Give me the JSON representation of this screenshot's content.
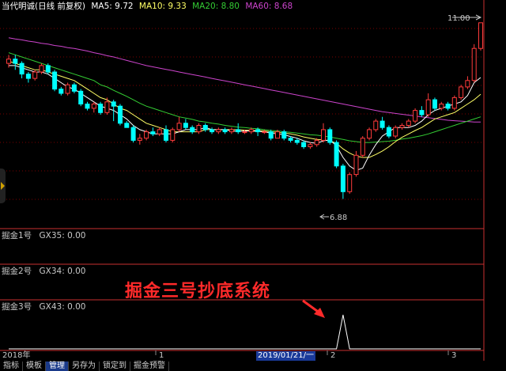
{
  "header": {
    "title": "当代明诚(日线 前复权)",
    "ma5_label": "MA5: 9.72",
    "ma10_label": "MA10: 9.33",
    "ma20_label": "MA20: 8.80",
    "ma60_label": "MA60: 8.68"
  },
  "price_labels": {
    "high": "11.00",
    "low": "6.88"
  },
  "indicators": [
    {
      "name": "掘金1号",
      "value": "GX35: 0.00"
    },
    {
      "name": "掘金2号",
      "value": "GX34: 0.00"
    },
    {
      "name": "掘金3号",
      "value": "GX43: 0.00"
    }
  ],
  "annotation": {
    "title": "掘金三号抄底系统"
  },
  "time_axis": {
    "year": "2018年",
    "tick1": "1",
    "cursor_date": "2019/01/21/一",
    "tick2": "2",
    "tick3": "3"
  },
  "bottom_tabs": [
    "指标",
    "模板",
    "管理",
    "另存为",
    "锁定到",
    "掘金预警"
  ],
  "colors": {
    "up": "#ff3b3b",
    "down": "#00ffff",
    "ma5": "#ffffff",
    "ma10": "#ffff66",
    "ma20": "#33cc33",
    "ma60": "#cc44cc",
    "grid": "#7a0000",
    "divider": "#c83030"
  },
  "chart_data": {
    "type": "candlestick",
    "y_range": [
      6.5,
      11.2
    ],
    "candles": [
      [
        10.05,
        10.15,
        10.25,
        9.95
      ],
      [
        10.15,
        10.05,
        10.25,
        9.9
      ],
      [
        10.05,
        9.8,
        10.1,
        9.7
      ],
      [
        9.8,
        9.7,
        9.85,
        9.6
      ],
      [
        9.7,
        9.85,
        9.9,
        9.65
      ],
      [
        9.85,
        10.0,
        10.05,
        9.8
      ],
      [
        10.0,
        9.85,
        10.05,
        9.8
      ],
      [
        9.85,
        9.45,
        9.9,
        9.4
      ],
      [
        9.45,
        9.35,
        9.5,
        9.3
      ],
      [
        9.35,
        9.55,
        9.6,
        9.3
      ],
      [
        9.55,
        9.4,
        9.6,
        9.35
      ],
      [
        9.4,
        9.1,
        9.45,
        9.05
      ],
      [
        9.1,
        9.0,
        9.15,
        8.95
      ],
      [
        9.0,
        9.1,
        9.15,
        8.9
      ],
      [
        9.1,
        8.9,
        9.15,
        8.85
      ],
      [
        8.9,
        9.15,
        9.25,
        8.85
      ],
      [
        9.15,
        9.05,
        9.2,
        8.7
      ],
      [
        9.05,
        8.65,
        9.1,
        8.6
      ],
      [
        8.65,
        8.55,
        8.7,
        8.55
      ],
      [
        8.55,
        8.25,
        8.6,
        8.2
      ],
      [
        8.25,
        8.3,
        8.4,
        8.15
      ],
      [
        8.3,
        8.45,
        8.5,
        8.25
      ],
      [
        8.45,
        8.4,
        8.55,
        8.35
      ],
      [
        8.4,
        8.5,
        8.55,
        8.35
      ],
      [
        8.5,
        8.25,
        8.6,
        8.2
      ],
      [
        8.25,
        8.5,
        8.55,
        8.2
      ],
      [
        8.5,
        8.65,
        8.8,
        8.45
      ],
      [
        8.65,
        8.55,
        8.75,
        8.5
      ],
      [
        8.55,
        8.45,
        8.6,
        8.4
      ],
      [
        8.45,
        8.6,
        8.65,
        8.4
      ],
      [
        8.6,
        8.5,
        8.65,
        8.45
      ],
      [
        8.5,
        8.45,
        8.55,
        8.4
      ],
      [
        8.45,
        8.5,
        8.55,
        8.4
      ],
      [
        8.5,
        8.45,
        8.55,
        8.4
      ],
      [
        8.45,
        8.5,
        8.55,
        8.4
      ],
      [
        8.5,
        8.45,
        8.65,
        8.4
      ],
      [
        8.45,
        8.45,
        8.5,
        8.4
      ],
      [
        8.45,
        8.5,
        8.55,
        8.4
      ],
      [
        8.5,
        8.45,
        8.55,
        8.35
      ],
      [
        8.45,
        8.45,
        8.5,
        8.4
      ],
      [
        8.45,
        8.3,
        8.5,
        8.25
      ],
      [
        8.3,
        8.45,
        8.5,
        8.3
      ],
      [
        8.45,
        8.3,
        8.5,
        8.25
      ],
      [
        8.3,
        8.25,
        8.35,
        8.2
      ],
      [
        8.25,
        8.2,
        8.3,
        8.15
      ],
      [
        8.2,
        8.1,
        8.25,
        8.05
      ],
      [
        8.1,
        8.15,
        8.2,
        8.05
      ],
      [
        8.15,
        8.25,
        8.3,
        8.1
      ],
      [
        8.25,
        8.5,
        8.65,
        8.2
      ],
      [
        8.5,
        8.2,
        8.55,
        8.15
      ],
      [
        8.2,
        7.65,
        8.25,
        7.6
      ],
      [
        7.65,
        7.05,
        7.7,
        6.88
      ],
      [
        7.05,
        7.45,
        7.5,
        7.0
      ],
      [
        7.45,
        7.9,
        8.0,
        7.4
      ],
      [
        7.9,
        8.3,
        8.35,
        7.85
      ],
      [
        8.3,
        8.5,
        8.55,
        8.25
      ],
      [
        8.5,
        8.7,
        8.75,
        8.45
      ],
      [
        8.7,
        8.55,
        8.8,
        8.5
      ],
      [
        8.55,
        8.35,
        8.6,
        8.3
      ],
      [
        8.35,
        8.55,
        8.6,
        8.3
      ],
      [
        8.55,
        8.6,
        8.65,
        8.5
      ],
      [
        8.6,
        8.7,
        8.75,
        8.55
      ],
      [
        8.7,
        8.95,
        9.0,
        8.65
      ],
      [
        8.95,
        8.85,
        9.05,
        8.8
      ],
      [
        8.85,
        9.2,
        9.35,
        8.8
      ],
      [
        9.2,
        9.0,
        9.25,
        8.95
      ],
      [
        9.0,
        9.1,
        9.15,
        8.95
      ],
      [
        9.1,
        9.0,
        9.15,
        8.95
      ],
      [
        9.0,
        9.25,
        9.3,
        8.95
      ],
      [
        9.25,
        9.5,
        9.55,
        9.2
      ],
      [
        9.5,
        9.65,
        9.75,
        9.45
      ],
      [
        9.65,
        10.4,
        10.5,
        9.6
      ],
      [
        10.4,
        11.0,
        11.0,
        10.35
      ]
    ],
    "ma5": [
      10.0,
      10.0,
      9.95,
      9.9,
      9.85,
      9.85,
      9.8,
      9.7,
      9.6,
      9.5,
      9.45,
      9.35,
      9.25,
      9.15,
      9.05,
      9.0,
      8.95,
      8.85,
      8.75,
      8.6,
      8.5,
      8.45,
      8.4,
      8.4,
      8.4,
      8.4,
      8.45,
      8.5,
      8.5,
      8.5,
      8.55,
      8.5,
      8.5,
      8.5,
      8.47,
      8.46,
      8.47,
      8.47,
      8.46,
      8.45,
      8.42,
      8.4,
      8.38,
      8.34,
      8.3,
      8.24,
      8.2,
      8.18,
      8.24,
      8.26,
      8.12,
      7.85,
      7.65,
      7.55,
      7.6,
      7.9,
      8.15,
      8.35,
      8.45,
      8.55,
      8.55,
      8.55,
      8.6,
      8.7,
      8.85,
      8.95,
      9.0,
      9.05,
      9.1,
      9.15,
      9.3,
      9.6,
      9.72
    ],
    "ma10": [
      10.1,
      10.05,
      10.0,
      9.95,
      9.9,
      9.9,
      9.85,
      9.8,
      9.75,
      9.7,
      9.65,
      9.55,
      9.45,
      9.35,
      9.25,
      9.2,
      9.1,
      9.0,
      8.95,
      8.85,
      8.75,
      8.65,
      8.6,
      8.55,
      8.5,
      8.45,
      8.45,
      8.45,
      8.45,
      8.45,
      8.5,
      8.5,
      8.5,
      8.5,
      8.5,
      8.5,
      8.49,
      8.48,
      8.48,
      8.47,
      8.45,
      8.44,
      8.42,
      8.4,
      8.37,
      8.33,
      8.3,
      8.27,
      8.26,
      8.24,
      8.18,
      8.05,
      7.95,
      7.88,
      7.85,
      7.85,
      7.92,
      8.0,
      8.1,
      8.22,
      8.32,
      8.4,
      8.48,
      8.55,
      8.65,
      8.75,
      8.8,
      8.85,
      8.9,
      9.0,
      9.1,
      9.2,
      9.33
    ],
    "ma20": [
      10.3,
      10.25,
      10.2,
      10.15,
      10.1,
      10.05,
      10.0,
      9.95,
      9.9,
      9.85,
      9.8,
      9.75,
      9.7,
      9.65,
      9.55,
      9.5,
      9.42,
      9.35,
      9.28,
      9.2,
      9.12,
      9.05,
      9.0,
      8.95,
      8.9,
      8.85,
      8.8,
      8.77,
      8.74,
      8.7,
      8.68,
      8.65,
      8.63,
      8.6,
      8.58,
      8.56,
      8.55,
      8.53,
      8.52,
      8.5,
      8.48,
      8.47,
      8.45,
      8.44,
      8.42,
      8.4,
      8.38,
      8.37,
      8.35,
      8.33,
      8.3,
      8.27,
      8.24,
      8.22,
      8.2,
      8.2,
      8.21,
      8.22,
      8.23,
      8.25,
      8.28,
      8.3,
      8.33,
      8.36,
      8.4,
      8.45,
      8.5,
      8.55,
      8.6,
      8.65,
      8.7,
      8.75,
      8.8
    ],
    "ma60": [
      10.65,
      10.62,
      10.6,
      10.57,
      10.55,
      10.52,
      10.5,
      10.47,
      10.45,
      10.42,
      10.4,
      10.37,
      10.34,
      10.3,
      10.27,
      10.23,
      10.2,
      10.16,
      10.12,
      10.08,
      10.04,
      10.0,
      9.97,
      9.94,
      9.91,
      9.88,
      9.85,
      9.82,
      9.79,
      9.76,
      9.73,
      9.7,
      9.67,
      9.64,
      9.61,
      9.58,
      9.55,
      9.52,
      9.49,
      9.46,
      9.43,
      9.4,
      9.37,
      9.34,
      9.31,
      9.28,
      9.25,
      9.22,
      9.19,
      9.16,
      9.13,
      9.1,
      9.07,
      9.04,
      9.01,
      8.98,
      8.95,
      8.92,
      8.9,
      8.88,
      8.86,
      8.84,
      8.82,
      8.8,
      8.78,
      8.76,
      8.74,
      8.72,
      8.71,
      8.7,
      8.69,
      8.68,
      8.68
    ],
    "gx43": [
      0,
      0,
      0,
      0,
      0,
      0,
      0,
      0,
      0,
      0,
      0,
      0,
      0,
      0,
      0,
      0,
      0,
      0,
      0,
      0,
      0,
      0,
      0,
      0,
      0,
      0,
      0,
      0,
      0,
      0,
      0,
      0,
      0,
      0,
      0,
      0,
      0,
      0,
      0,
      0,
      0,
      0,
      0,
      0,
      0,
      0,
      0,
      0,
      0,
      0,
      0,
      1,
      0,
      0,
      0,
      0,
      0,
      0,
      0,
      0,
      0,
      0,
      0,
      0,
      0,
      0,
      0,
      0,
      0,
      0,
      0,
      0,
      0
    ]
  }
}
